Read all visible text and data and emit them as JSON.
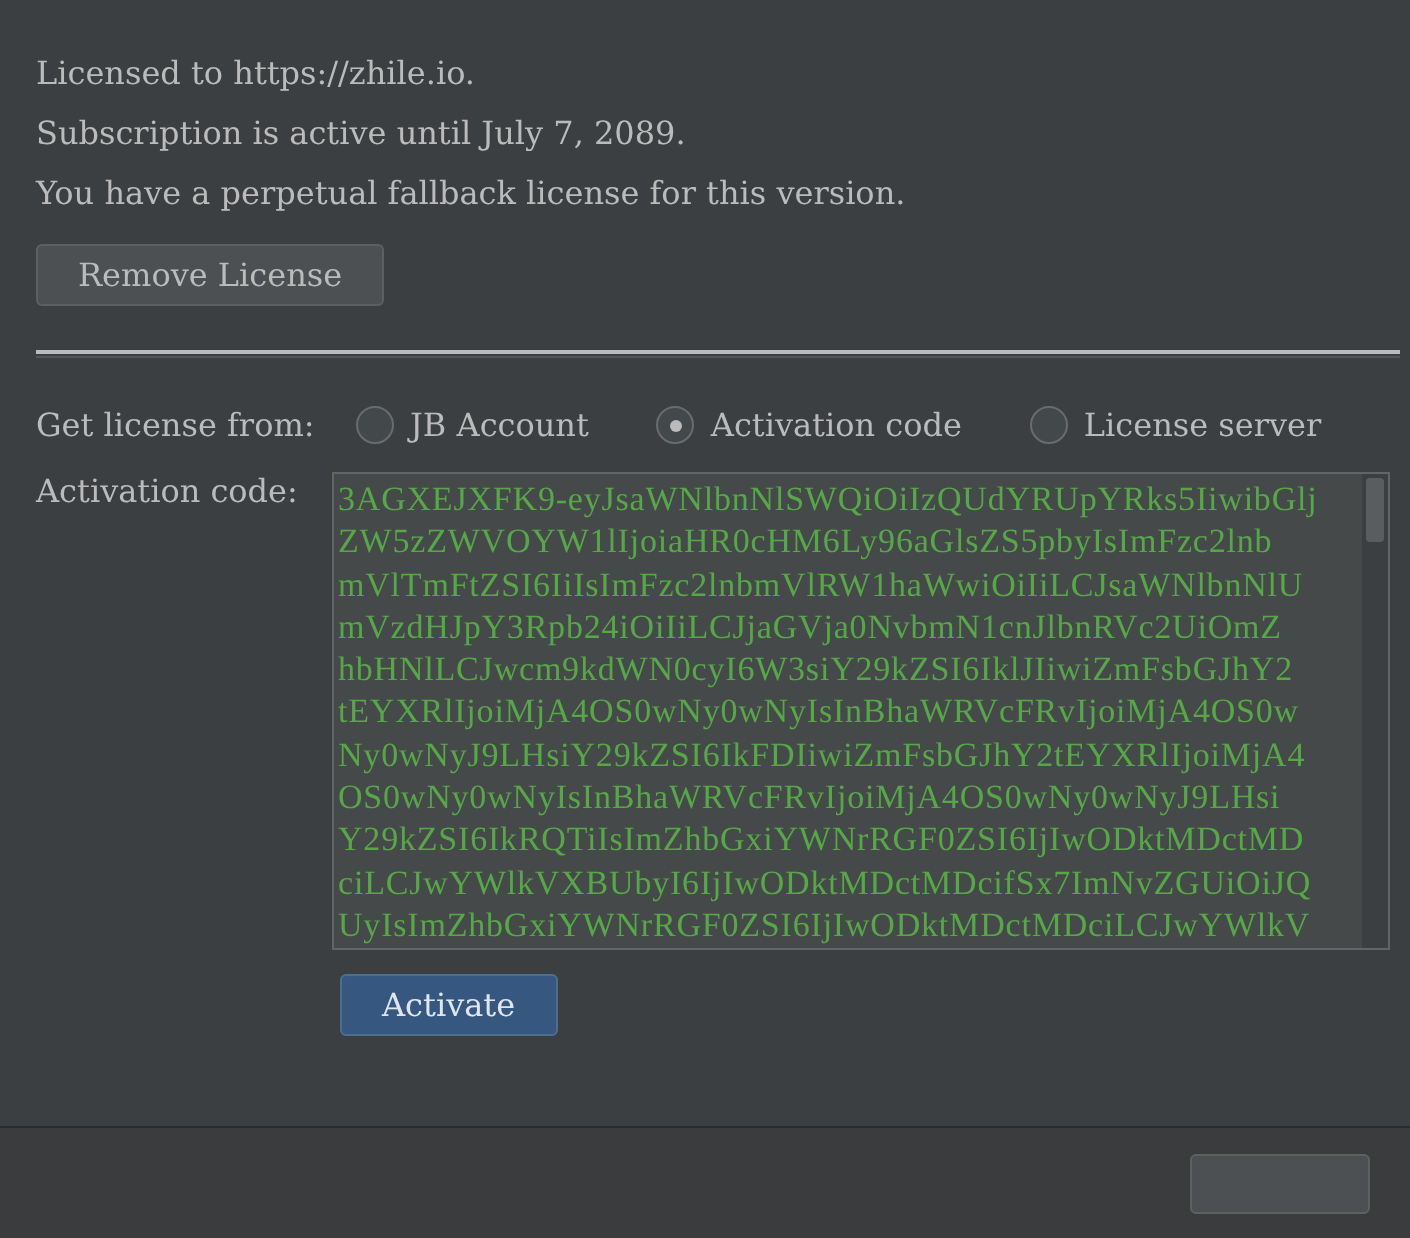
{
  "license_info": [
    "Licensed to https://zhile.io.",
    "Subscription is active until July 7, 2089.",
    "You have a perpetual fallback license for this version."
  ],
  "remove_button": "Remove License",
  "source": {
    "label": "Get license from:",
    "options": [
      {
        "label": "JB Account",
        "selected": false
      },
      {
        "label": "Activation code",
        "selected": true
      },
      {
        "label": "License server",
        "selected": false
      }
    ]
  },
  "activation_code": {
    "label": "Activation code:",
    "lines": [
      "3AGXEJXFK9-eyJsaWNlbnNlSWQiOiIzQUdYRUpYRks5IiwibGlj",
      "ZW5zZWVOYW1lIjoiaHR0cHM6Ly96aGlsZS5pbyIsImFzc2lnb",
      "mVlTmFtZSI6IiIsImFzc2lnbmVlRW1haWwiOiIiLCJsaWNlbnNlU",
      "mVzdHJpY3Rpb24iOiIiLCJjaGVja0NvbmN1cnJlbnRVc2UiOmZ",
      "hbHNlLCJwcm9kdWN0cyI6W3siY29kZSI6IklJIiwiZmFsbGJhY2",
      "tEYXRlIjoiMjA4OS0wNy0wNyIsInBhaWRVcFRvIjoiMjA4OS0w",
      "Ny0wNyJ9LHsiY29kZSI6IkFDIiwiZmFsbGJhY2tEYXRlIjoiMjA4",
      "OS0wNy0wNyIsInBhaWRVcFRvIjoiMjA4OS0wNy0wNyJ9LHsi",
      "Y29kZSI6IkRQTiIsImZhbGxiYWNrRGF0ZSI6IjIwODktMDctMD",
      "ciLCJwYWlkVXBUbyI6IjIwODktMDctMDcifSx7ImNvZGUiOiJQ",
      "UyIsImZhbGxiYWNrRGF0ZSI6IjIwODktMDctMDciLCJwYWlkV"
    ]
  },
  "activate_button": "Activate"
}
